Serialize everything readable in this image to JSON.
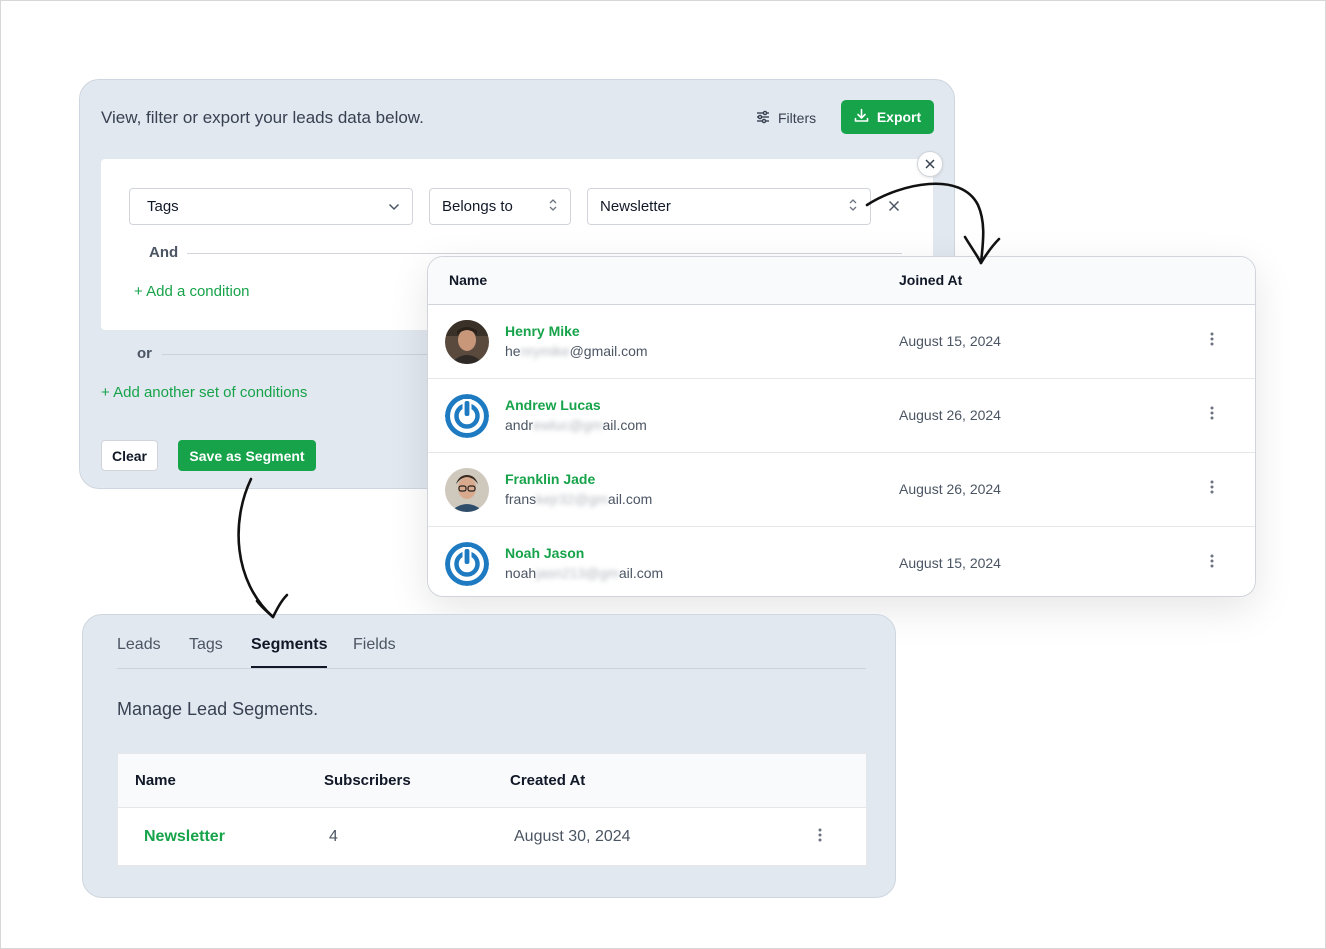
{
  "filter_panel": {
    "description": "View, filter or export your leads data below.",
    "filters_label": "Filters",
    "export_label": "Export",
    "condition": {
      "field": "Tags",
      "operator": "Belongs to",
      "value": "Newsletter"
    },
    "and_label": "And",
    "add_condition": "+ Add a condition",
    "or_label": "or",
    "add_set": "+ Add another set of conditions",
    "clear_label": "Clear",
    "save_label": "Save as Segment"
  },
  "leads_table": {
    "columns": [
      "Name",
      "Joined At"
    ],
    "rows": [
      {
        "name": "Henry Mike",
        "email_start": "he",
        "email_hidden": "nrymike",
        "email_end": "@gmail.com",
        "joined": "August 15, 2024",
        "avatar": "photo"
      },
      {
        "name": "Andrew Lucas",
        "email_start": "andr",
        "email_hidden": "ewluc@gm",
        "email_end": "ail.com",
        "joined": "August 26, 2024",
        "avatar": "power-icon"
      },
      {
        "name": "Franklin Jade",
        "email_start": "frans",
        "email_hidden": "kejr32@gm",
        "email_end": "ail.com",
        "joined": "August 26, 2024",
        "avatar": "photo"
      },
      {
        "name": "Noah Jason",
        "email_start": "noah",
        "email_hidden": "jasn213@gm",
        "email_end": "ail.com",
        "joined": "August 15, 2024",
        "avatar": "power-icon"
      }
    ]
  },
  "segments_panel": {
    "tabs": [
      "Leads",
      "Tags",
      "Segments",
      "Fields"
    ],
    "active_tab": "Segments",
    "description": "Manage Lead Segments.",
    "columns": [
      "Name",
      "Subscribers",
      "Created At"
    ],
    "rows": [
      {
        "name": "Newsletter",
        "subscribers": "4",
        "created": "August 30, 2024"
      }
    ]
  },
  "colors": {
    "accent": "#16a34a",
    "panel_bg": "#e2e8f0",
    "avatar_blue": "#1e7bc1"
  }
}
